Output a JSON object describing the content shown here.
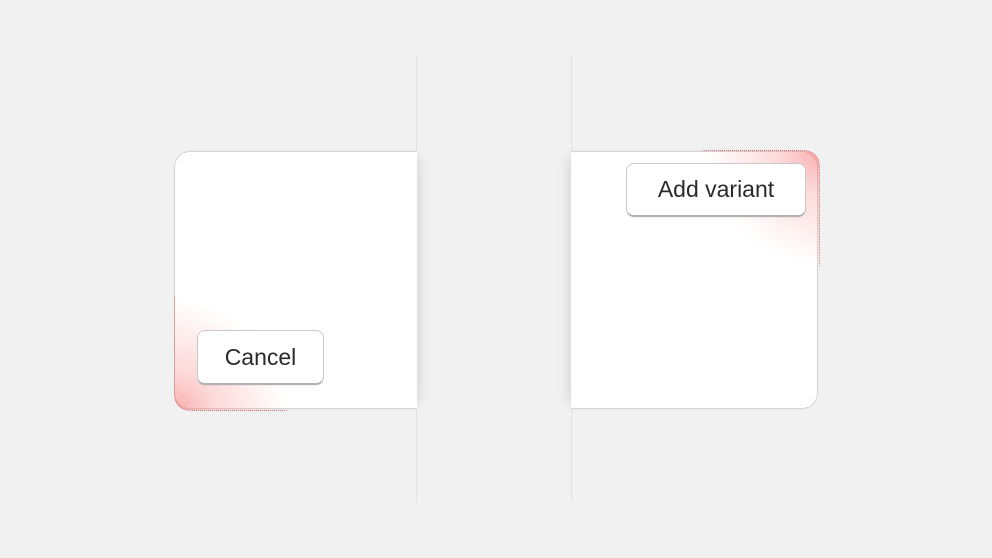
{
  "buttons": {
    "cancel_label": "Cancel",
    "add_variant_label": "Add variant"
  },
  "colors": {
    "background": "#f1f1f1",
    "card": "#ffffff",
    "highlight": "#f26b6b"
  }
}
